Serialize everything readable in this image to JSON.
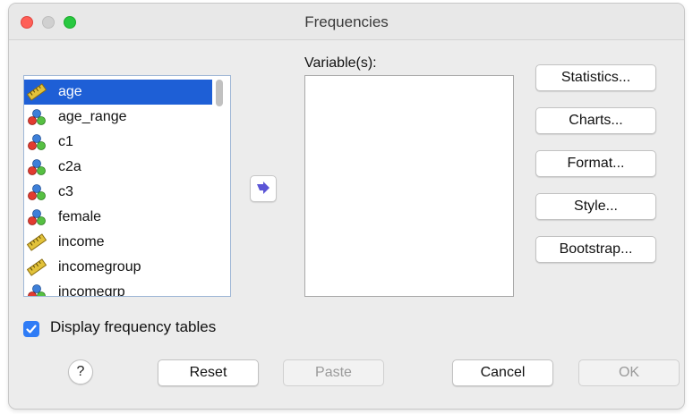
{
  "window": {
    "title": "Frequencies"
  },
  "variable_list": {
    "items": [
      {
        "label": "age",
        "icon": "scale-ruler-icon",
        "selected": true
      },
      {
        "label": "age_range",
        "icon": "nominal-icon",
        "selected": false
      },
      {
        "label": "c1",
        "icon": "nominal-icon",
        "selected": false
      },
      {
        "label": "c2a",
        "icon": "nominal-icon",
        "selected": false
      },
      {
        "label": "c3",
        "icon": "nominal-icon",
        "selected": false
      },
      {
        "label": "female",
        "icon": "nominal-icon",
        "selected": false
      },
      {
        "label": "income",
        "icon": "scale-ruler-icon",
        "selected": false
      },
      {
        "label": "incomegroup",
        "icon": "scale-ruler-icon",
        "selected": false
      },
      {
        "label": "incomegrp",
        "icon": "nominal-icon",
        "selected": false
      }
    ]
  },
  "target": {
    "label": "Variable(s):"
  },
  "side_buttons": {
    "statistics": "Statistics...",
    "charts": "Charts...",
    "format": "Format...",
    "style": "Style...",
    "bootstrap": "Bootstrap..."
  },
  "options": {
    "display_frequency_tables": "Display frequency tables",
    "checked": true
  },
  "footer": {
    "help": "?",
    "reset": "Reset",
    "paste": "Paste",
    "cancel": "Cancel",
    "ok": "OK"
  },
  "colors": {
    "selection": "#1e5fd6",
    "checkbox": "#2f7cf6",
    "arrow": "#5b55d6"
  }
}
